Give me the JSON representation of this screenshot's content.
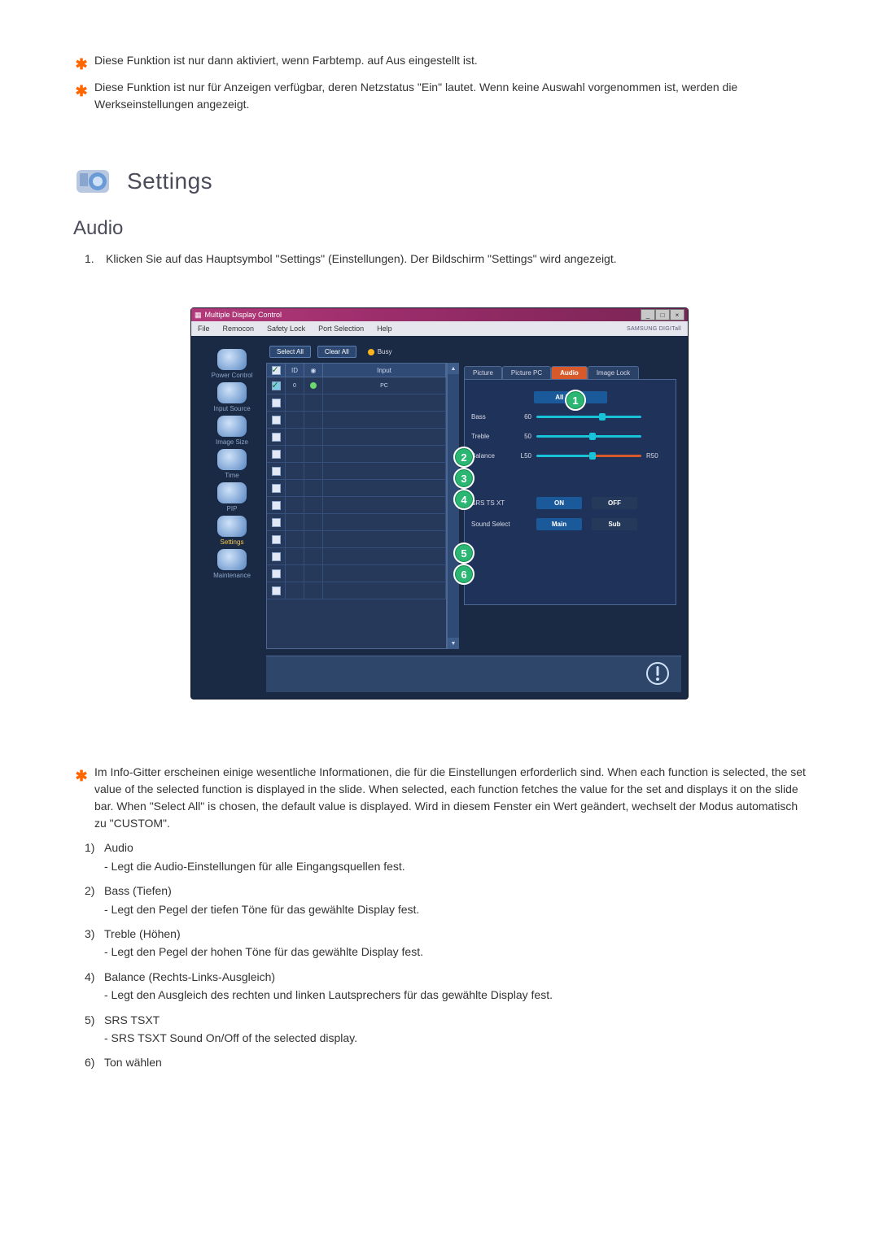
{
  "notes": {
    "n1": "Diese Funktion ist nur dann aktiviert, wenn Farbtemp. auf Aus eingestellt ist.",
    "n2": "Diese Funktion ist nur für Anzeigen verfügbar, deren Netzstatus \"Ein\" lautet. Wenn keine Auswahl vorgenommen ist, werden die Werkseinstellungen angezeigt."
  },
  "h1": "Settings",
  "h2": "Audio",
  "step1": {
    "num": "1.",
    "text": "Klicken Sie auf das Hauptsymbol \"Settings\" (Einstellungen). Der Bildschirm \"Settings\" wird angezeigt."
  },
  "app": {
    "title": "Multiple Display Control",
    "menu": [
      "File",
      "Remocon",
      "Safety Lock",
      "Port Selection",
      "Help"
    ],
    "brand": "SAMSUNG DIGITall",
    "sidebar": [
      {
        "label": "Power Control"
      },
      {
        "label": "Input Source"
      },
      {
        "label": "Image Size"
      },
      {
        "label": "Time"
      },
      {
        "label": "PIP"
      },
      {
        "label": "Settings"
      },
      {
        "label": "Maintenance"
      }
    ],
    "buttons": {
      "selectAll": "Select All",
      "clearAll": "Clear All",
      "busy": "Busy"
    },
    "grid": {
      "headers": {
        "id": "ID",
        "input": "Input"
      },
      "row": {
        "id": "0",
        "input": "PC"
      }
    },
    "tabs": {
      "picture": "Picture",
      "picturePC": "Picture PC",
      "audio": "Audio",
      "imageLock": "Image Lock"
    },
    "panel": {
      "allInputs": "All Inputs",
      "bass": {
        "label": "Bass",
        "value": "60"
      },
      "treble": {
        "label": "Treble",
        "value": "50"
      },
      "balance": {
        "label": "Balance",
        "left": "L50",
        "right": "R50"
      },
      "srs": {
        "label": "SRS TS XT",
        "on": "ON",
        "off": "OFF"
      },
      "sound": {
        "label": "Sound Select",
        "main": "Main",
        "sub": "Sub"
      }
    }
  },
  "infoNote": "Im Info-Gitter erscheinen einige wesentliche Informationen, die für die Einstellungen erforderlich sind. When each function is selected, the set value of the selected function is displayed in the slide. When selected, each function fetches the value for the set and displays it on the slide bar. When \"Select All\" is chosen, the default value is displayed. Wird in diesem Fenster ein Wert geändert, wechselt der Modus automatisch zu \"CUSTOM\".",
  "items": {
    "i1": {
      "num": "1)",
      "title": "Audio",
      "desc": "- Legt die Audio-Einstellungen für alle Eingangsquellen fest."
    },
    "i2": {
      "num": "2)",
      "title": "Bass (Tiefen)",
      "desc": "- Legt den Pegel der tiefen Töne für das gewählte Display fest."
    },
    "i3": {
      "num": "3)",
      "title": "Treble (Höhen)",
      "desc": "- Legt den Pegel der hohen Töne für das gewählte Display fest."
    },
    "i4": {
      "num": "4)",
      "title": "Balance (Rechts-Links-Ausgleich)",
      "desc": "- Legt den Ausgleich des rechten und linken Lautsprechers für das gewählte Display fest."
    },
    "i5": {
      "num": "5)",
      "title": "SRS TSXT",
      "desc": "- SRS TSXT Sound On/Off of the selected display."
    },
    "i6": {
      "num": "6)",
      "title": "Ton wählen"
    }
  },
  "callouts": {
    "c1": "1",
    "c2": "2",
    "c3": "3",
    "c4": "4",
    "c5": "5",
    "c6": "6"
  }
}
